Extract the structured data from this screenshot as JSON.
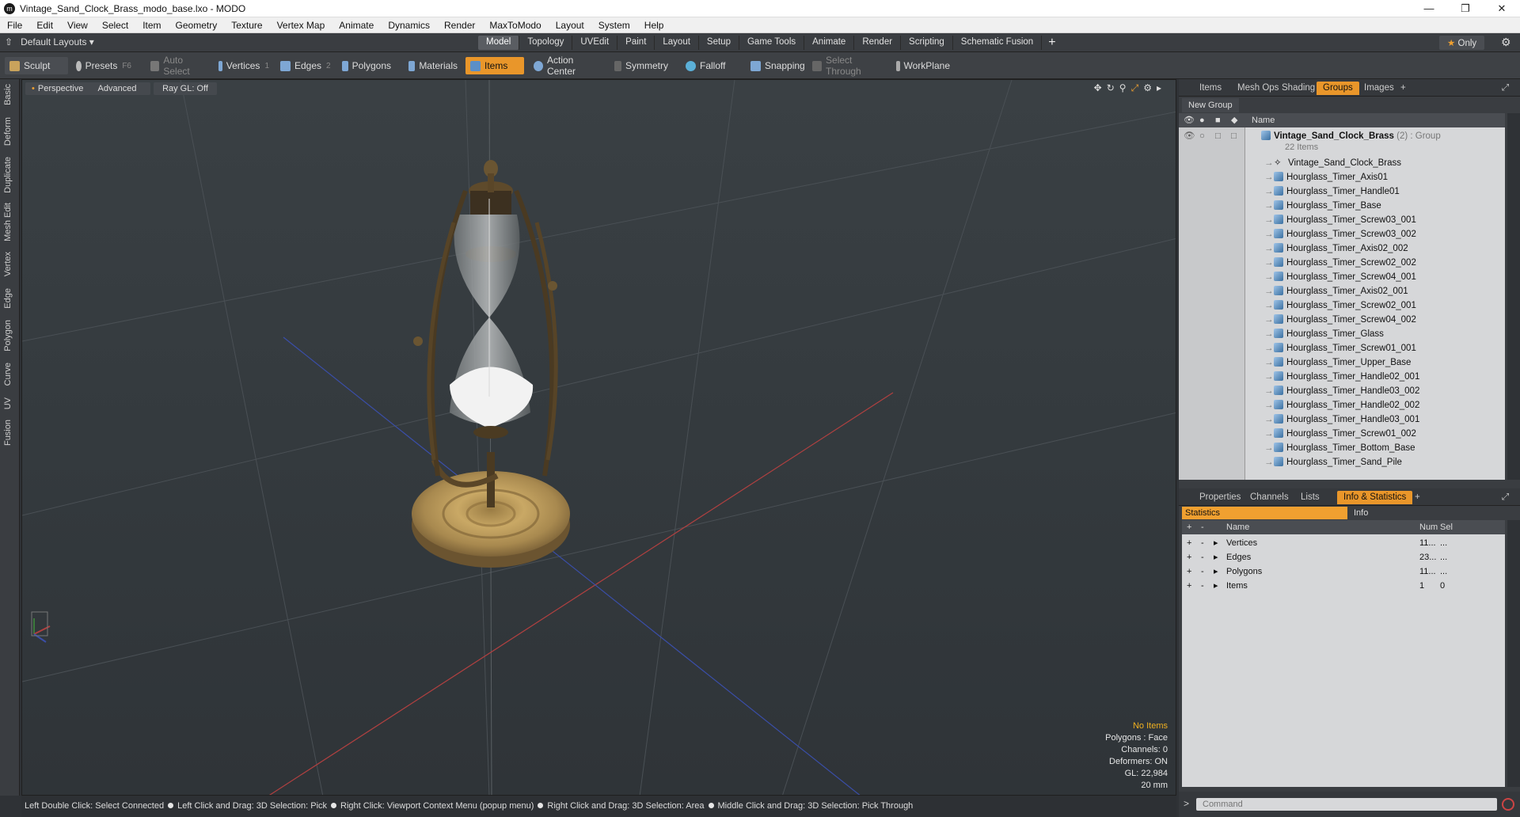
{
  "window": {
    "title": "Vintage_Sand_Clock_Brass_modo_base.lxo - MODO",
    "app_icon": "modo-icon"
  },
  "menu": [
    "File",
    "Edit",
    "View",
    "Select",
    "Item",
    "Geometry",
    "Texture",
    "Vertex Map",
    "Animate",
    "Dynamics",
    "Render",
    "MaxToModo",
    "Layout",
    "System",
    "Help"
  ],
  "layoutbar": {
    "layout_label": "Default Layouts ▾",
    "tabs": [
      "Model",
      "Topology",
      "UVEdit",
      "Paint",
      "Layout",
      "Setup",
      "Game Tools",
      "Animate",
      "Render",
      "Scripting",
      "Schematic Fusion"
    ],
    "active_tab": "Model",
    "only_label": "Only"
  },
  "toolbar": {
    "sculpt": "Sculpt",
    "presets": "Presets",
    "presets_key": "F6",
    "auto_select": "Auto Select",
    "vertices": "Vertices",
    "vertices_key": "1",
    "edges": "Edges",
    "edges_key": "2",
    "polygons": "Polygons",
    "materials": "Materials",
    "items": "Items",
    "action_center": "Action Center",
    "symmetry": "Symmetry",
    "falloff": "Falloff",
    "snapping": "Snapping",
    "select_through": "Select Through",
    "workplane": "WorkPlane"
  },
  "left_tabs": [
    "Basic",
    "Deform",
    "Duplicate",
    "Mesh Edit",
    "Vertex",
    "Edge",
    "Polygon",
    "Curve",
    "UV",
    "Fusion"
  ],
  "viewport": {
    "perspective": "Perspective",
    "advanced": "Advanced",
    "raygl": "Ray GL: Off",
    "info": {
      "no_items": "No Items",
      "polygons": "Polygons : Face",
      "channels": "Channels: 0",
      "deformers": "Deformers: ON",
      "gl": "GL: 22,984",
      "scale": "20 mm"
    }
  },
  "statusbar": [
    "Left Double Click: Select Connected",
    "Left Click and Drag: 3D Selection: Pick",
    "Right Click: Viewport Context Menu (popup menu)",
    "Right Click and Drag: 3D Selection: Area",
    "Middle Click and Drag: 3D Selection: Pick Through"
  ],
  "right_top_tabs": [
    "Items",
    "Mesh Ops",
    "Shading",
    "Groups",
    "Images"
  ],
  "right_top_active": "Groups",
  "groups": {
    "new_group": "New Group",
    "name_header": "Name",
    "group_name": "Vintage_Sand_Clock_Brass",
    "group_suffix": "(2) : Group",
    "group_count": "22 Items",
    "items": [
      "Vintage_Sand_Clock_Brass",
      "Hourglass_Timer_Axis01",
      "Hourglass_Timer_Handle01",
      "Hourglass_Timer_Base",
      "Hourglass_Timer_Screw03_001",
      "Hourglass_Timer_Screw03_002",
      "Hourglass_Timer_Axis02_002",
      "Hourglass_Timer_Screw02_002",
      "Hourglass_Timer_Screw04_001",
      "Hourglass_Timer_Axis02_001",
      "Hourglass_Timer_Screw02_001",
      "Hourglass_Timer_Screw04_002",
      "Hourglass_Timer_Glass",
      "Hourglass_Timer_Screw01_001",
      "Hourglass_Timer_Upper_Base",
      "Hourglass_Timer_Handle02_001",
      "Hourglass_Timer_Handle03_002",
      "Hourglass_Timer_Handle02_002",
      "Hourglass_Timer_Handle03_001",
      "Hourglass_Timer_Screw01_002",
      "Hourglass_Timer_Bottom_Base",
      "Hourglass_Timer_Sand_Pile"
    ]
  },
  "right_bottom_tabs": [
    "Properties",
    "Channels",
    "Lists",
    "Info & Statistics"
  ],
  "right_bottom_active": "Info & Statistics",
  "stats": {
    "statistics_label": "Statistics",
    "info_label": "Info",
    "col_name": "Name",
    "col_num": "Num",
    "col_sel": "Sel",
    "rows": [
      {
        "name": "Vertices",
        "num": "11...",
        "sel": "..."
      },
      {
        "name": "Edges",
        "num": "23...",
        "sel": "..."
      },
      {
        "name": "Polygons",
        "num": "11...",
        "sel": "..."
      },
      {
        "name": "Items",
        "num": "1",
        "sel": "0"
      }
    ]
  },
  "command": {
    "placeholder": "Command"
  },
  "colors": {
    "accent": "#e9962a",
    "panel": "#3a3d41",
    "list_bg": "#d6d7d9"
  }
}
